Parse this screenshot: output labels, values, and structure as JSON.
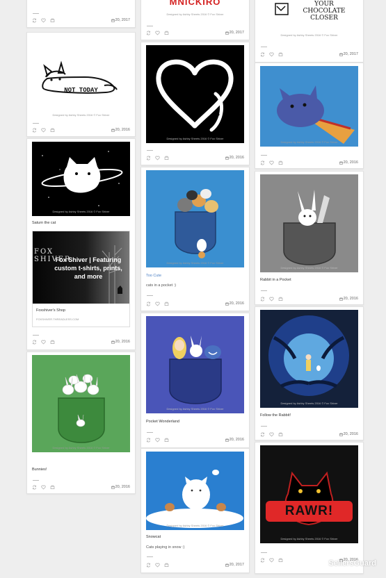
{
  "credit": "Designed by Ashby Sheets 2016 © Fox Shiver",
  "cards": {
    "c1a": {
      "date": "20, 2017"
    },
    "c1b": {
      "art_text": "NOT TODAY",
      "date": "20, 2016"
    },
    "c1c": {
      "title": "Saturn the cat"
    },
    "c1ad": {
      "brand": "FOX SHIVER",
      "headline": "Fox Shiver | Featuring custom t-shirts, prints, and more",
      "title": "Foxshiver's Shop",
      "url": "FOXSHIVER.THREADLESS.COM",
      "date": "20, 2016"
    },
    "c1d": {
      "title": "Bunnies!",
      "date": "20, 2016"
    },
    "c2a": {
      "art_text": "MNICKIRO",
      "date": "20, 2017"
    },
    "c2b": {
      "date": "20, 2016"
    },
    "c2c": {
      "title": "Too Cute",
      "desc": "cats in a pocket :)",
      "date": "20, 2016"
    },
    "c2d": {
      "title": "Pocket Wonderland",
      "date": "20, 2016"
    },
    "c2e": {
      "title": "Snowcat",
      "desc": "Cats playing in snow :)",
      "date": "20, 2017"
    },
    "c3a": {
      "art_text": "YOUR CHOCOLATE CLOSER",
      "date": "20, 2017"
    },
    "c3b": {
      "date": "20, 2016"
    },
    "c3c": {
      "title": "Rabbit in a Pocket",
      "date": "20, 2016"
    },
    "c3d": {
      "title": "Follow the Rabbit!",
      "date": "20, 2016"
    },
    "c3e": {
      "art_text": "RAWR!",
      "date": "20, 2016"
    }
  },
  "watermark": "SellersGuard",
  "icons": [
    "share-icon",
    "like-icon",
    "comment-icon",
    "calendar-icon"
  ],
  "colors": {
    "background": "#eeeeee",
    "link": "#4a7fc4",
    "green": "#5aa65a",
    "blue": "#3a8fd0"
  }
}
